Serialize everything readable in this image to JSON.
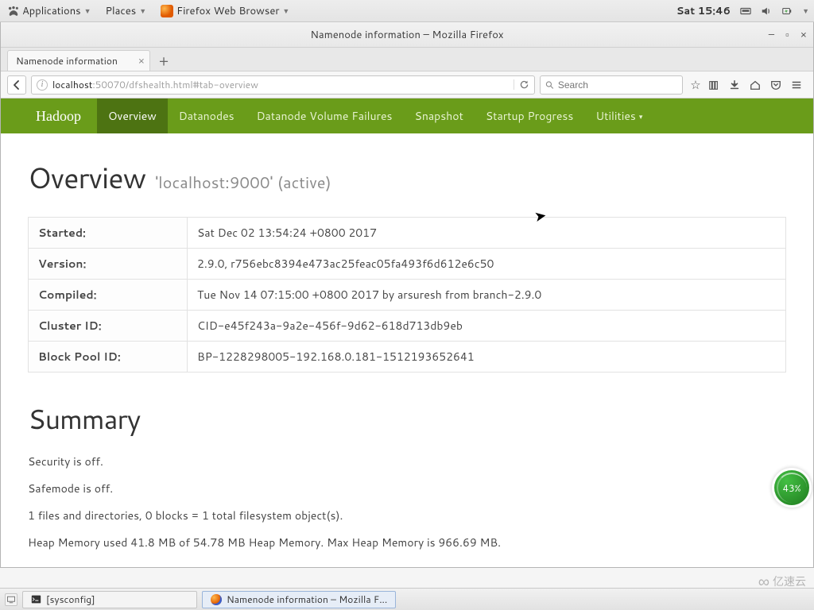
{
  "gnome": {
    "applications": "Applications",
    "places": "Places",
    "appTitle": "Firefox Web Browser",
    "clock": "Sat 15:46"
  },
  "window": {
    "title": "Namenode information – Mozilla Firefox"
  },
  "tab": {
    "title": "Namenode information"
  },
  "url": {
    "host": "localhost",
    "rest": ":50070/dfshealth.html#tab-overview"
  },
  "search": {
    "placeholder": "Search"
  },
  "nav": {
    "brand": "Hadoop",
    "items": [
      "Overview",
      "Datanodes",
      "Datanode Volume Failures",
      "Snapshot",
      "Startup Progress",
      "Utilities"
    ]
  },
  "overview": {
    "heading": "Overview",
    "subhead": "'localhost:9000' (active)",
    "rows": [
      {
        "label": "Started:",
        "value": "Sat Dec 02 13:54:24 +0800 2017"
      },
      {
        "label": "Version:",
        "value": "2.9.0, r756ebc8394e473ac25feac05fa493f6d612e6c50"
      },
      {
        "label": "Compiled:",
        "value": "Tue Nov 14 07:15:00 +0800 2017 by arsuresh from branch-2.9.0"
      },
      {
        "label": "Cluster ID:",
        "value": "CID-e45f243a-9a2e-456f-9d62-618d713db9eb"
      },
      {
        "label": "Block Pool ID:",
        "value": "BP-1228298005-192.168.0.181-1512193652641"
      }
    ]
  },
  "summary": {
    "heading": "Summary",
    "lines": [
      "Security is off.",
      "Safemode is off.",
      "1 files and directories, 0 blocks = 1 total filesystem object(s).",
      "Heap Memory used 41.8 MB of 54.78 MB Heap Memory. Max Heap Memory is 966.69 MB."
    ]
  },
  "badge": {
    "percent": "43%"
  },
  "watermark": "亿速云",
  "taskbar": {
    "item1": "[sysconfig]",
    "item2": "Namenode information – Mozilla F..."
  }
}
